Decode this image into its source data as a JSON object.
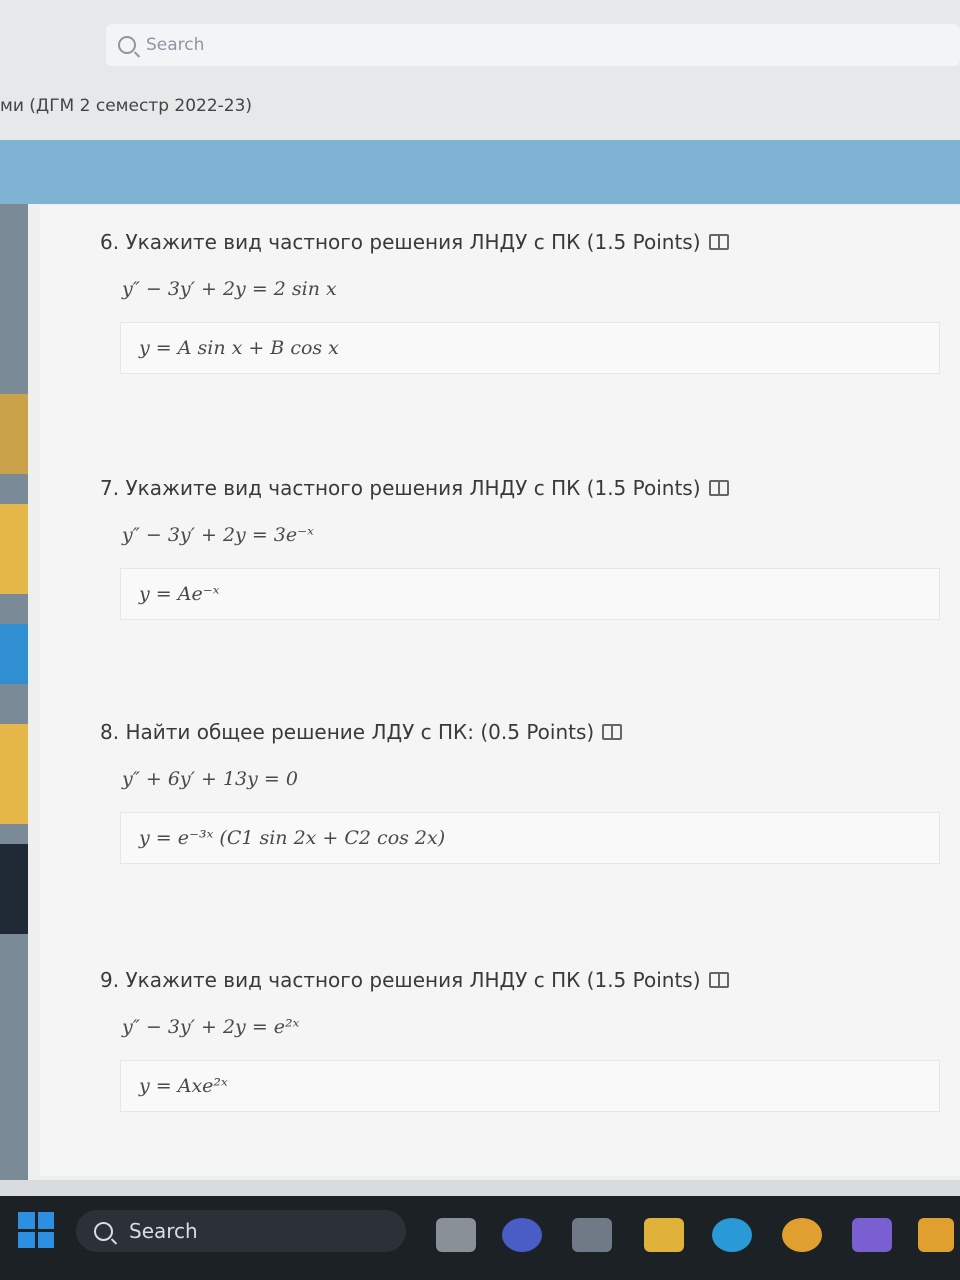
{
  "header": {
    "search_placeholder": "Search",
    "course_title": "ми (ДГМ 2 семестр 2022-23)"
  },
  "questions": [
    {
      "title": "6. Укажите вид частного решения ЛНДУ с ПК (1.5 Points)",
      "equation": "y″ − 3y′ + 2y = 2 sin x",
      "answer": "y = A sin x + B cos x"
    },
    {
      "title": "7. Укажите вид частного решения ЛНДУ с ПК (1.5 Points)",
      "equation": "y″ − 3y′ + 2y = 3e⁻ˣ",
      "answer": "y = Ae⁻ˣ"
    },
    {
      "title": "8. Найти общее решение ЛДУ с ПК: (0.5 Points)",
      "equation": "y″ + 6y′ + 13y = 0",
      "answer": "y = e⁻³ˣ (C1 sin 2x + C2 cos 2x)"
    },
    {
      "title": "9. Укажите вид частного решения ЛНДУ с ПК (1.5 Points)",
      "equation": "y″ − 3y′ + 2y = e²ˣ",
      "answer": "y = Axe²ˣ"
    }
  ],
  "taskbar": {
    "search_label": "Search",
    "apps": [
      "file-explorer-icon",
      "meet-icon",
      "store-icon",
      "folder-icon",
      "edge-icon",
      "chrome-icon",
      "visual-studio-icon",
      "files-icon"
    ]
  }
}
